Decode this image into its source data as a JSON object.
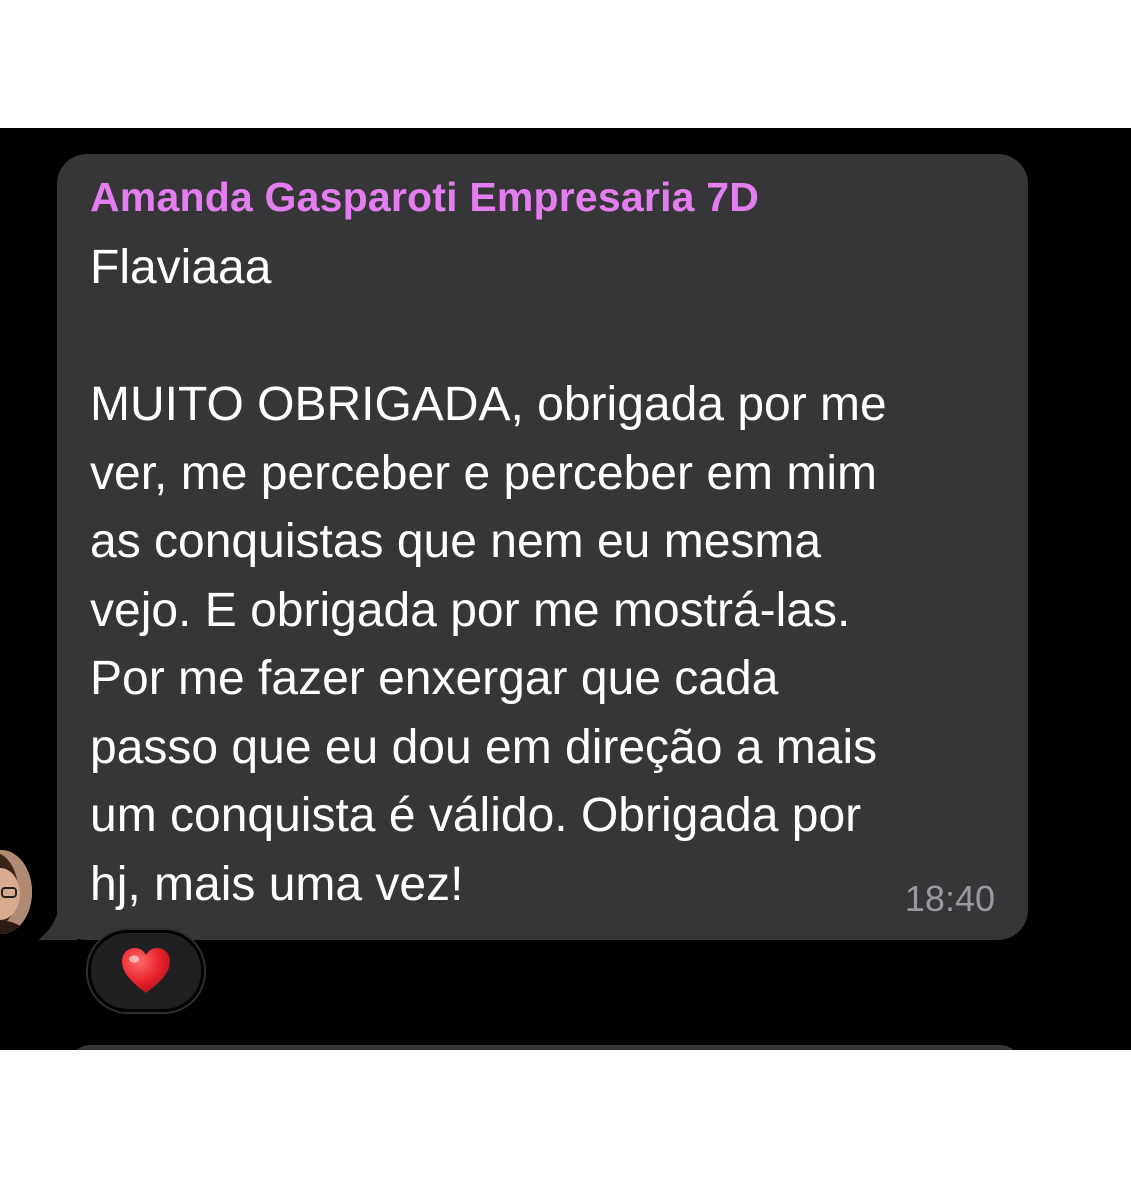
{
  "message": {
    "sender": "Amanda Gasparoti Empresaria 7D",
    "text": "Flaviaaa\n\nMUITO OBRIGADA, obrigada por me\nver, me perceber e perceber em mim\nas conquistas que nem eu mesma\nvejo. E obrigada por me mostrá-las.\nPor me fazer enxergar que cada\npasso que eu dou em direção a mais\num conquista é válido. Obrigada por\nhj, mais uma vez!",
    "time": "18:40",
    "reaction_icon": "heart-icon"
  },
  "colors": {
    "chat_background": "#000000",
    "bubble_background": "#363638",
    "sender_name": "#e47df0",
    "message_text": "#ffffff",
    "timestamp": "#9a9a9e",
    "reaction": "#e8232b"
  }
}
